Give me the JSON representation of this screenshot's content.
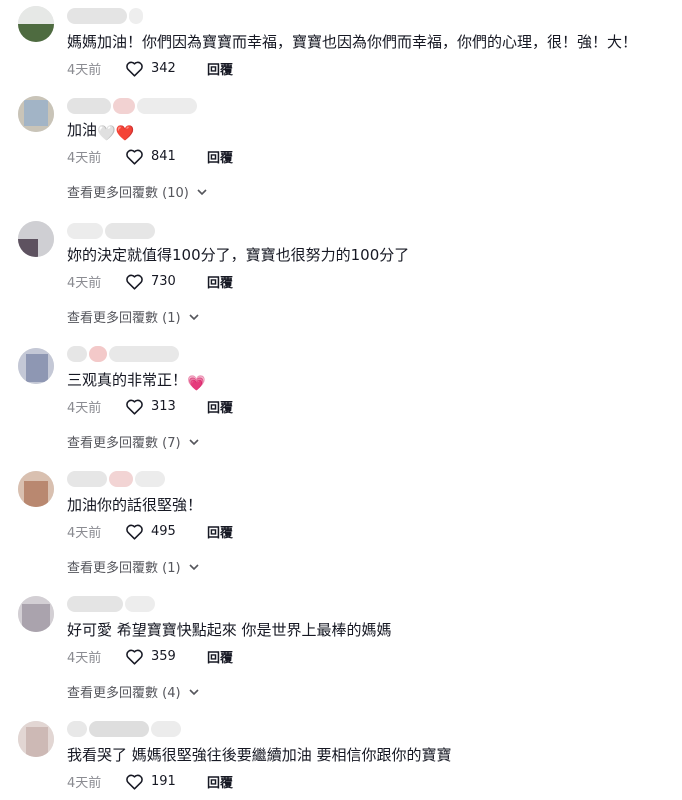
{
  "comments": [
    {
      "text": "媽媽加油！你們因為寶寶而幸福，寶寶也因為你們而幸福，你們的心理，很！強！大！",
      "emoji": "",
      "time": "4天前",
      "likes": "342",
      "reply": "回覆",
      "more": ""
    },
    {
      "text": "加油",
      "emoji": "🤍❤️",
      "time": "4天前",
      "likes": "841",
      "reply": "回覆",
      "more": "查看更多回覆數 (10)"
    },
    {
      "text": "妳的決定就值得100分了，寶寶也很努力的100分了",
      "emoji": "",
      "time": "4天前",
      "likes": "730",
      "reply": "回覆",
      "more": "查看更多回覆數 (1)"
    },
    {
      "text": "三观真的非常正！",
      "emoji": "💗",
      "time": "4天前",
      "likes": "313",
      "reply": "回覆",
      "more": "查看更多回覆數 (7)"
    },
    {
      "text": "加油你的話很堅強！",
      "emoji": "",
      "time": "4天前",
      "likes": "495",
      "reply": "回覆",
      "more": "查看更多回覆數 (1)"
    },
    {
      "text": "好可愛 希望寶寶快點起來 你是世界上最棒的媽媽",
      "emoji": "",
      "time": "4天前",
      "likes": "359",
      "reply": "回覆",
      "more": "查看更多回覆數 (4)"
    },
    {
      "text": "我看哭了 媽媽很堅強往後要繼續加油 要相信你跟你的寶寶",
      "emoji": "",
      "time": "4天前",
      "likes": "191",
      "reply": "回覆",
      "more": ""
    }
  ],
  "icons": {
    "like": "heart-outline-icon",
    "expand": "chevron-down-icon"
  }
}
